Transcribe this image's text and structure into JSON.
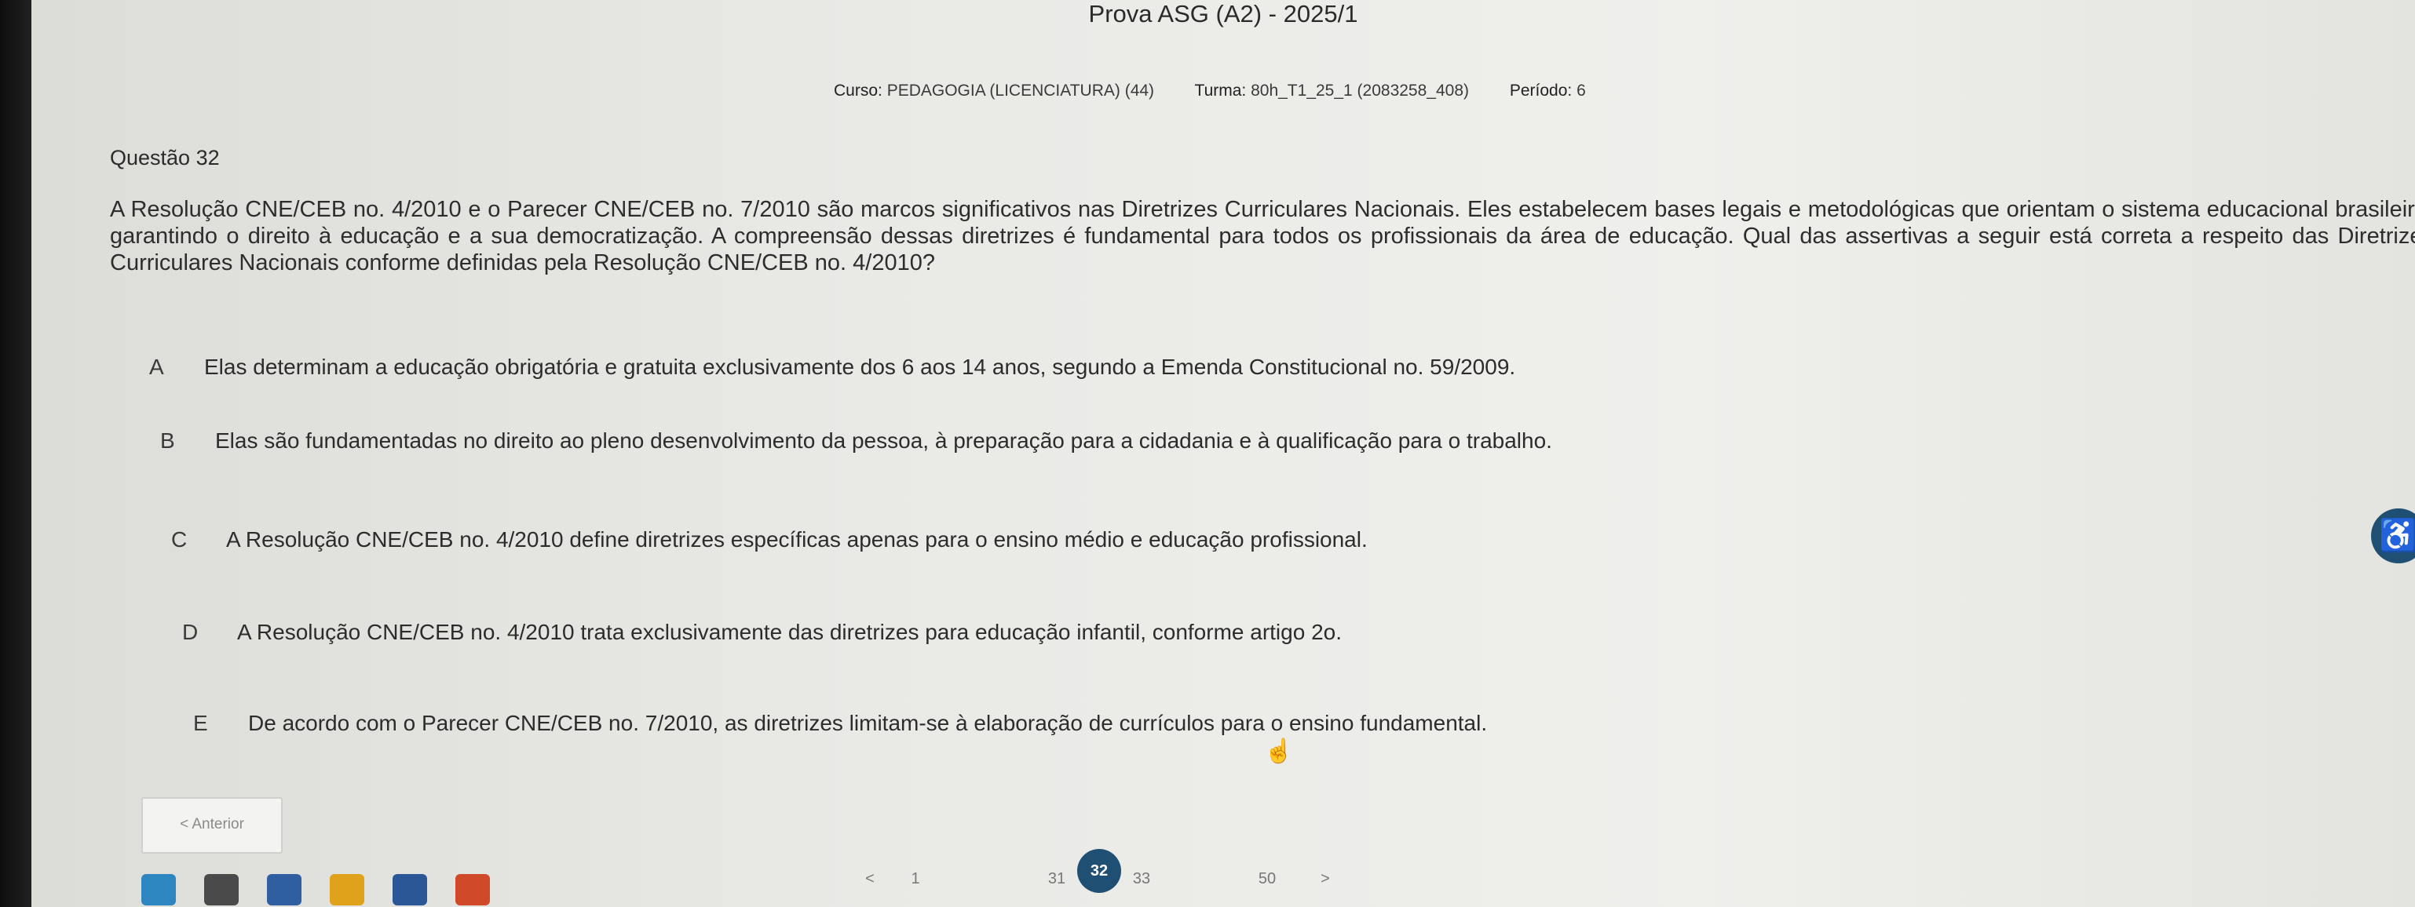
{
  "header": {
    "title": "Prova ASG (A2) - 2025/1",
    "course_label": "Curso:",
    "course_value": "PEDAGOGIA (LICENCIATURA) (44)",
    "class_label": "Turma:",
    "class_value": "80h_T1_25_1 (2083258_408)",
    "period_label": "Período:",
    "period_value": "6"
  },
  "question": {
    "number_label": "Questão 32",
    "text": "A Resolução CNE/CEB no. 4/2010 e o Parecer CNE/CEB no. 7/2010 são marcos significativos nas Diretrizes Curriculares Nacionais. Eles estabelecem bases legais e metodológicas que orientam o sistema educacional brasileiro, garantindo o direito à educação e a sua democratização. A compreensão dessas diretrizes é fundamental para todos os profissionais da área de educação. Qual das assertivas a seguir está correta a respeito das Diretrizes Curriculares Nacionais conforme definidas pela Resolução CNE/CEB no. 4/2010?"
  },
  "options": [
    {
      "letter": "A",
      "text": "Elas determinam a educação obrigatória e gratuita exclusivamente dos 6 aos 14 anos, segundo a Emenda Constitucional no. 59/2009."
    },
    {
      "letter": "B",
      "text": "Elas são fundamentadas no direito ao pleno desenvolvimento da pessoa, à preparação para a cidadania e à qualificação para o trabalho."
    },
    {
      "letter": "C",
      "text": "A Resolução CNE/CEB no. 4/2010 define diretrizes específicas apenas para o ensino médio e educação profissional."
    },
    {
      "letter": "D",
      "text": "A Resolução CNE/CEB no. 4/2010 trata exclusivamente das diretrizes para educação infantil, conforme artigo 2o."
    },
    {
      "letter": "E",
      "text": "De acordo com o Parecer CNE/CEB no. 7/2010, as diretrizes limitam-se à elaboração de currículos para o ensino fundamental."
    }
  ],
  "navigation": {
    "prev_label": "< Anterior",
    "pager_prev": "<",
    "pager_next": ">",
    "pages": [
      "1",
      "31",
      "32",
      "33",
      "50"
    ],
    "current_page": "32"
  },
  "icons": {
    "accessibility": "accessibility-icon",
    "cursor": "hand-cursor-icon"
  },
  "colors": {
    "accent": "#1f4f73"
  }
}
